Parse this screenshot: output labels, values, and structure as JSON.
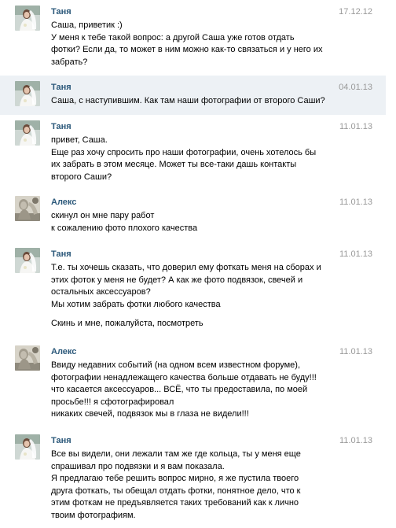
{
  "messages": [
    {
      "author": "Таня",
      "date": "17.12.12",
      "avatar": "bride-photo",
      "lines": [
        "Саша, приветик :)",
        "У меня к тебе такой вопрос: а другой Саша уже готов отдать",
        "фотки? Если да, то может в ним можно как-то связаться и у него их",
        "забрать?"
      ]
    },
    {
      "author": "Таня",
      "date": "04.01.13",
      "avatar": "bride-photo",
      "highlighted": true,
      "lines": [
        "Саша, с наступившим. Как там наши фотографии от второго Саши?"
      ]
    },
    {
      "author": "Таня",
      "date": "11.01.13",
      "avatar": "bride-photo",
      "lines": [
        "привет, Саша.",
        "Еще раз хочу спросить про наши фотографии, очень хотелось бы",
        "их забрать в этом месяце. Может ты все-таки дашь контакты",
        "второго Саши?"
      ]
    },
    {
      "author": "Алекс",
      "date": "11.01.13",
      "avatar": "statue-photo",
      "lines": [
        "скинул он мне пару работ",
        "к сожалению фото плохого качества"
      ]
    },
    {
      "author": "Таня",
      "date": "11.01.13",
      "avatar": "bride-photo",
      "lines": [
        "Т.е. ты хочешь сказать, что доверил ему фоткать меня на сборах и",
        "этих фоток у меня не будет? А как же фото подвязок, свечей и",
        "остальных аксессуаров?",
        "Мы хотим забрать фотки любого качества",
        "",
        "Скинь и мне, пожалуйста, посмотреть"
      ]
    },
    {
      "author": "Алекс",
      "date": "11.01.13",
      "avatar": "statue-photo",
      "lines": [
        "Ввиду недавних событий (на одном всем известном форуме),",
        "фотографии ненадлежащего качества больше отдавать не буду!!!",
        "что касается аксессуаров... ВСЁ, что ты предоставила, по моей",
        "просьбе!!! я сфотографировал",
        "никаких свечей, подвязок мы в глаза не видели!!!"
      ]
    },
    {
      "author": "Таня",
      "date": "11.01.13",
      "avatar": "bride-photo",
      "lines": [
        "Все вы видели, они лежали там же где кольца, ты у меня еще",
        "спрашивал про подвязки и я вам показала.",
        "Я предлагаю тебе решить вопрос мирно, я же пустила твоего",
        "друга фоткать, ты обещал отдать фотки, понятное дело, что к",
        "этим фоткам не предъявляется таких требований как к лично",
        "твоим фотографиям."
      ]
    }
  ]
}
